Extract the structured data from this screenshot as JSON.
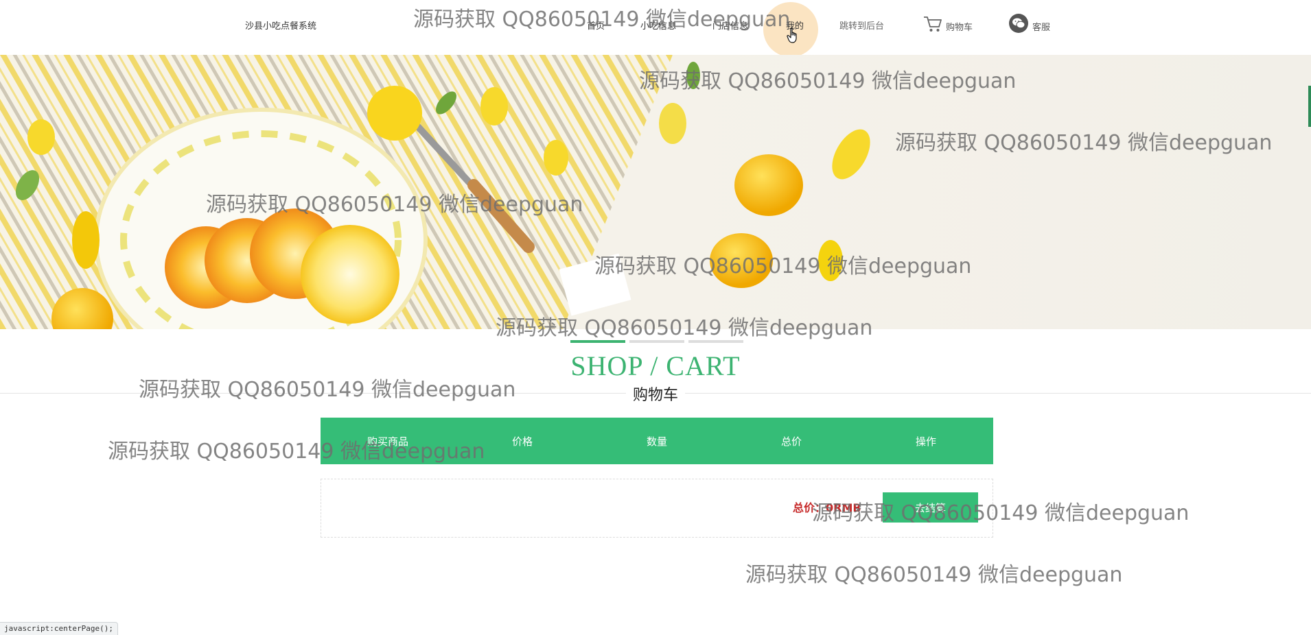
{
  "header": {
    "brand": "沙县小吃点餐系统",
    "nav": [
      {
        "label": "首页"
      },
      {
        "label": "小吃信息"
      },
      {
        "label": "门店信息"
      },
      {
        "label": "我的"
      },
      {
        "label": "跳转到后台"
      }
    ],
    "cart_label": "购物车",
    "service_label": "客服"
  },
  "section": {
    "title": "SHOP / CART",
    "subtitle": "购物车"
  },
  "cart": {
    "columns": [
      "购买商品",
      "价格",
      "数量",
      "总价",
      "操作"
    ],
    "total_label": "总价：0RMB",
    "checkout_label": "去结算"
  },
  "watermark": "源码获取 QQ86050149 微信deepguan",
  "status_bar": "javascript:centerPage();",
  "colors": {
    "accent": "#35bd77",
    "title_green": "#3cb371",
    "total_red": "#c62828",
    "active_nav_bg": "#fbe4c2"
  }
}
